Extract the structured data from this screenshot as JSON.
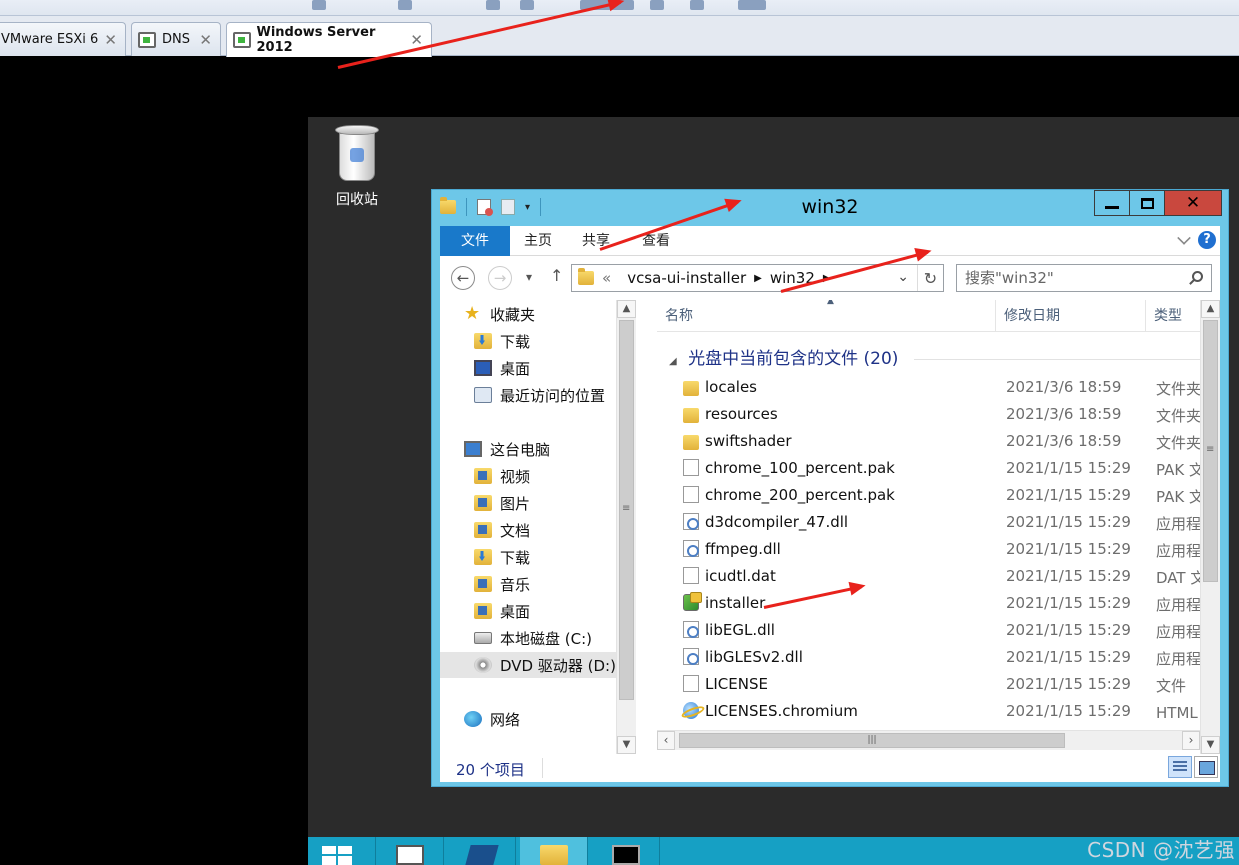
{
  "host": {
    "tabs": [
      {
        "label": "VMware ESXi 6"
      },
      {
        "label": "DNS"
      },
      {
        "label": "Windows Server 2012"
      }
    ]
  },
  "desktop": {
    "recycle_bin_label": "回收站"
  },
  "explorer": {
    "title": "win32",
    "ribbon_tabs": [
      "文件",
      "主页",
      "共享",
      "查看"
    ],
    "address": {
      "overflow": "«",
      "crumbs": [
        "vcsa-ui-installer",
        "win32"
      ]
    },
    "search_placeholder": "搜索\"win32\"",
    "nav": {
      "favorites": "收藏夹",
      "downloads": "下载",
      "desktop": "桌面",
      "recent": "最近访问的位置",
      "this_pc": "这台电脑",
      "videos": "视频",
      "pictures": "图片",
      "documents": "文档",
      "downloads2": "下载",
      "music": "音乐",
      "desktop2": "桌面",
      "local_disk": "本地磁盘 (C:)",
      "dvd": "DVD 驱动器 (D:) V",
      "network": "网络"
    },
    "columns": {
      "name": "名称",
      "date": "修改日期",
      "type": "类型"
    },
    "group_header": "光盘中当前包含的文件 (20)",
    "files": [
      {
        "name": "locales",
        "date": "2021/3/6 18:59",
        "type": "文件夹",
        "icon": "folder"
      },
      {
        "name": "resources",
        "date": "2021/3/6 18:59",
        "type": "文件夹",
        "icon": "folder"
      },
      {
        "name": "swiftshader",
        "date": "2021/3/6 18:59",
        "type": "文件夹",
        "icon": "folder"
      },
      {
        "name": "chrome_100_percent.pak",
        "date": "2021/1/15 15:29",
        "type": "PAK 文件",
        "icon": "doc"
      },
      {
        "name": "chrome_200_percent.pak",
        "date": "2021/1/15 15:29",
        "type": "PAK 文件",
        "icon": "doc"
      },
      {
        "name": "d3dcompiler_47.dll",
        "date": "2021/1/15 15:29",
        "type": "应用程序扩展",
        "icon": "dll"
      },
      {
        "name": "ffmpeg.dll",
        "date": "2021/1/15 15:29",
        "type": "应用程序扩展",
        "icon": "dll"
      },
      {
        "name": "icudtl.dat",
        "date": "2021/1/15 15:29",
        "type": "DAT 文件",
        "icon": "doc"
      },
      {
        "name": "installer",
        "date": "2021/1/15 15:29",
        "type": "应用程序",
        "icon": "app"
      },
      {
        "name": "libEGL.dll",
        "date": "2021/1/15 15:29",
        "type": "应用程序扩展",
        "icon": "dll"
      },
      {
        "name": "libGLESv2.dll",
        "date": "2021/1/15 15:29",
        "type": "应用程序扩展",
        "icon": "dll"
      },
      {
        "name": "LICENSE",
        "date": "2021/1/15 15:29",
        "type": "文件",
        "icon": "doc"
      },
      {
        "name": "LICENSES.chromium",
        "date": "2021/1/15 15:29",
        "type": "HTML 文档",
        "icon": "html"
      }
    ],
    "status": {
      "item_count": "20 个项目"
    }
  },
  "watermark": "CSDN @沈艺强",
  "colors": {
    "accent": "#1979ca",
    "window_frame": "#6dc7e8",
    "taskbar": "#16a0c4",
    "annotation_arrow": "#e8221c"
  }
}
